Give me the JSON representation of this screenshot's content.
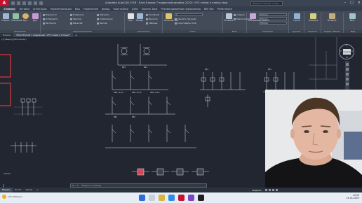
{
  "window": {
    "title": "Autodesk AutoCAD 2018 · Блок Блоков 7 надежный декабрь 2022г (VT2 схемы и планы).dwg",
    "search_placeholder": "Введите ключев. слово/фразу",
    "logo_letter": "A"
  },
  "ribbon_tabs": [
    "Главная",
    "Вставка",
    "Аннотации",
    "Параметризация",
    "Вид",
    "Управление",
    "Вывод",
    "Надстройки",
    "A360",
    "Express Tools",
    "Рекомендованные приложения",
    "BIM 360",
    "Performance"
  ],
  "ribbon_groups": {
    "draw": {
      "title": "Рисование",
      "buttons": [
        "Отрезок",
        "Полилиния",
        "Круг",
        "Дуга"
      ]
    },
    "modify": {
      "title": "Редактирование",
      "rows": [
        "Перенести",
        "Повернуть",
        "Обрезать",
        "Копировать",
        "Зеркало",
        "Сопряжение",
        "Растянуть",
        "Масштаб",
        "Массив"
      ]
    },
    "annotation": {
      "title": "Аннотации",
      "buttons": [
        "Текст",
        "Размер"
      ],
      "rows": [
        "Линейный",
        "Выноска",
        "Таблица"
      ]
    },
    "layers": {
      "title": "Слои",
      "buttons": [
        "Свойства слоя"
      ],
      "rows": [
        "Сделать текущим",
        "Сопоставить слой"
      ],
      "current_layer": "0"
    },
    "block": {
      "title": "Блок",
      "buttons": [
        "Вставить"
      ],
      "rows": [
        "Создать",
        "Редактировать"
      ]
    },
    "properties": {
      "title": "Свойства",
      "buttons": [
        "Копирование свойств"
      ],
      "rows": [
        "ПоСлою",
        "ПоСлою",
        "ПоСлою"
      ]
    },
    "groups": {
      "title": "Группы",
      "buttons": [
        "Группа"
      ]
    },
    "utilities": {
      "title": "Утилиты",
      "buttons": [
        "Измерить"
      ]
    },
    "clipboard": {
      "title": "Буфер обмена",
      "buttons": [
        "Вставить"
      ]
    },
    "view": {
      "title": "Вид",
      "buttons": [
        "База"
      ]
    }
  },
  "doc_tabs": [
    "Начало",
    "Блок Блоков 7 надежный...VT2 схемы и планы)*"
  ],
  "drawing": {
    "view_label": "[-][Сверху][2D-каркас]",
    "viewcube": {
      "face": "Сверху",
      "n": "С",
      "s": "Ю",
      "w": "З",
      "e": "В",
      "ucs": "МСК"
    },
    "switch_label": "ВР1",
    "wire_label": "ПВ1 1х1,5"
  },
  "command_line": {
    "prompt": "Введите команду",
    "close": "×"
  },
  "layout_tabs": [
    "Модель",
    "Лист1",
    "Лист2"
  ],
  "status": {
    "model": "МОДЕЛЬ"
  },
  "taskbar": {
    "weather": "-3°C Облачно",
    "time": "12:03",
    "date": "21.01.2023"
  },
  "colors": {
    "canvas": "#212631",
    "ribbon": "#434b58",
    "accent": "#c8102e",
    "wire": "#e6e6e6"
  }
}
